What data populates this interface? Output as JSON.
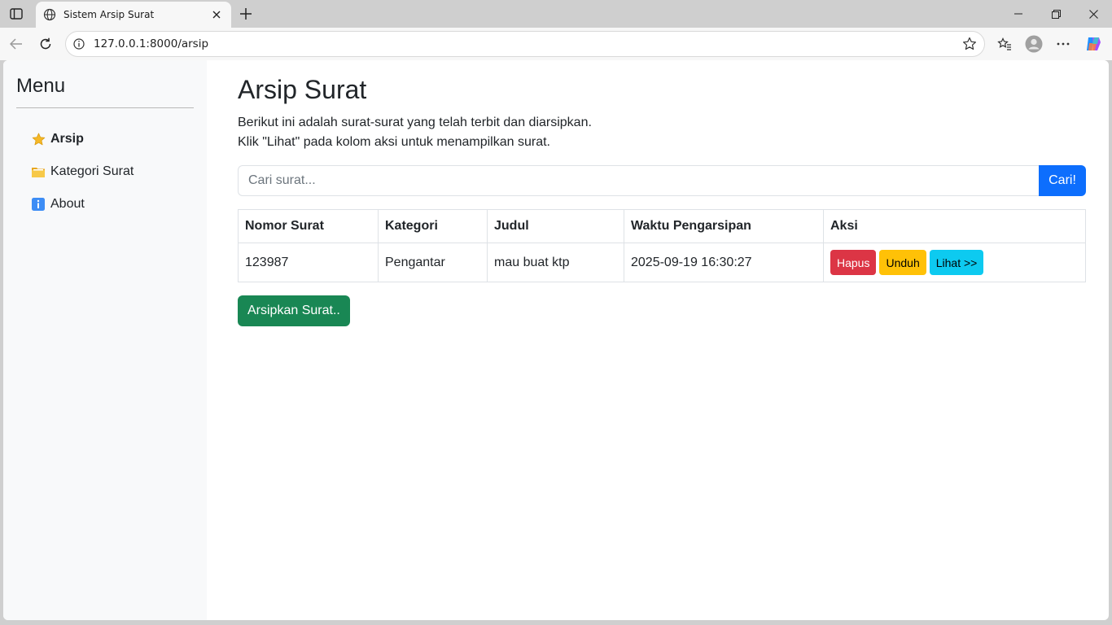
{
  "browser": {
    "tab_title": "Sistem Arsip Surat",
    "url": "127.0.0.1:8000/arsip"
  },
  "sidebar": {
    "title": "Menu",
    "items": [
      {
        "label": "Arsip",
        "icon": "star-icon",
        "active": true
      },
      {
        "label": "Kategori Surat",
        "icon": "folder-icon",
        "active": false
      },
      {
        "label": "About",
        "icon": "info-icon",
        "active": false
      }
    ]
  },
  "main": {
    "title": "Arsip Surat",
    "desc_line1": "Berikut ini adalah surat-surat yang telah terbit dan diarsipkan.",
    "desc_line2": "Klik \"Lihat\" pada kolom aksi untuk menampilkan surat.",
    "search": {
      "placeholder": "Cari surat...",
      "button_label": "Cari!"
    },
    "table": {
      "headers": [
        "Nomor Surat",
        "Kategori",
        "Judul",
        "Waktu Pengarsipan",
        "Aksi"
      ],
      "rows": [
        {
          "nomor": "123987",
          "kategori": "Pengantar",
          "judul": "mau buat ktp",
          "waktu": "2025-09-19 16:30:27"
        }
      ],
      "actions": {
        "delete": "Hapus",
        "download": "Unduh",
        "view": "Lihat >>"
      }
    },
    "archive_button": "Arsipkan Surat.."
  },
  "colors": {
    "primary": "#0d6efd",
    "danger": "#dc3545",
    "warning": "#ffc107",
    "info": "#0dcaf0",
    "success": "#198754"
  }
}
